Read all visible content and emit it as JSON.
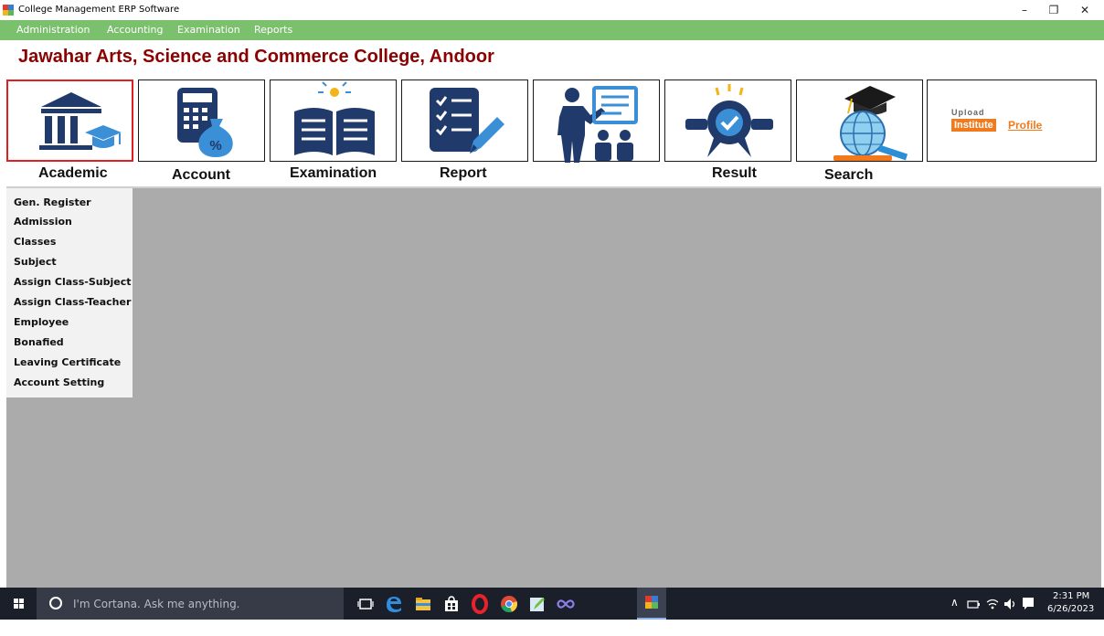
{
  "window": {
    "title": "College Management ERP  Software",
    "minimize": "–",
    "maximize": "❐",
    "close": "✕"
  },
  "menu": [
    "Administration",
    "Accounting",
    "Examination",
    "Reports"
  ],
  "college_name": "Jawahar Arts, Science and Commerce College, Andoor",
  "tiles": [
    {
      "label": "Academic",
      "icon": "institution-graduation-icon",
      "active": true
    },
    {
      "label": "Account",
      "icon": "calculator-money-bag-icon"
    },
    {
      "label": "Examination",
      "icon": "open-book-lightbulb-icon"
    },
    {
      "label": "Report",
      "icon": "checklist-pencil-icon"
    },
    {
      "label": "",
      "icon": "teacher-presentation-icon"
    },
    {
      "label": "Result",
      "icon": "award-badge-icon"
    },
    {
      "label": "Search",
      "icon": "globe-magnifier-graduation-cap-icon"
    }
  ],
  "profile_tile": {
    "upload": "Upload",
    "institute": "Institute",
    "profile": "Profile"
  },
  "side_menu": [
    "Gen. Register",
    "Admission",
    "Classes",
    "Subject",
    "Assign Class-Subject",
    "Assign Class-Teacher",
    "Employee",
    "Bonafied",
    "Leaving Certificate",
    "Account Setting"
  ],
  "taskbar": {
    "search_placeholder": "I'm Cortana. Ask me anything.",
    "time": "2:31 PM",
    "date": "6/26/2023",
    "tray_symbols": "∧"
  },
  "colors": {
    "menu_bg": "#7bc06d",
    "college_title": "#8b0000",
    "icon_navy": "#1f3a6b",
    "accent_blue": "#3b8fd6",
    "orange": "#f07a1c"
  }
}
